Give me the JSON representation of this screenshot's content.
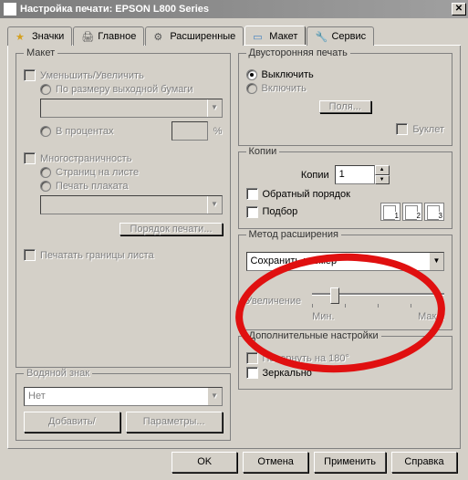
{
  "window": {
    "title": "Настройка печати: EPSON L800 Series"
  },
  "tabs": {
    "icons": "Значки",
    "main": "Главное",
    "advanced": "Расширенные",
    "layout": "Макет",
    "service": "Сервис"
  },
  "layout_group": {
    "legend": "Макет",
    "reduce_enlarge": "Уменьшить/Увеличить",
    "fit_output": "По размеру выходной бумаги",
    "percent": "В процентах",
    "percent_unit": "%",
    "multipage": "Многостраничность",
    "pages_per_sheet": "Страниц на листе",
    "poster": "Печать плаката",
    "print_order_btn": "Порядок печати...",
    "print_borders": "Печатать границы листа"
  },
  "watermark": {
    "legend": "Водяной знак",
    "none": "Нет",
    "add_remove_btn": "Добавить/Удалить...",
    "params_btn": "Параметры..."
  },
  "duplex": {
    "legend": "Двусторонняя печать",
    "off": "Выключить",
    "on": "Включить",
    "margins_btn": "Поля...",
    "booklet": "Буклет"
  },
  "copies": {
    "legend": "Копии",
    "label": "Копии",
    "value": "1",
    "reverse": "Обратный порядок",
    "collate": "Подбор",
    "page_nums": [
      "1",
      "2",
      "3"
    ]
  },
  "expansion": {
    "legend": "Метод расширения",
    "method_value": "Сохранить размер",
    "enlarge_label": "Увеличение",
    "min": "Мин.",
    "max": "Макс."
  },
  "extra": {
    "legend": "Дополнительные настройки",
    "rotate": "Повернуть на 180°",
    "mirror": "Зеркально"
  },
  "buttons": {
    "ok": "OK",
    "cancel": "Отмена",
    "apply": "Применить",
    "help": "Справка"
  }
}
